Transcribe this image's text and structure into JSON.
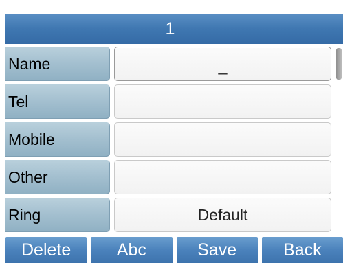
{
  "title": "1",
  "form": {
    "rows": [
      {
        "label": "Name",
        "value": "_"
      },
      {
        "label": "Tel",
        "value": ""
      },
      {
        "label": "Mobile",
        "value": ""
      },
      {
        "label": "Other",
        "value": ""
      },
      {
        "label": "Ring",
        "value": "Default"
      }
    ]
  },
  "softkeys": {
    "delete": "Delete",
    "abc": "Abc",
    "save": "Save",
    "back": "Back"
  },
  "colors": {
    "title_bar": "#3f77b1",
    "label_bg": "#a3bfcf",
    "field_bg": "#f4f4f4",
    "softkey_bg": "#4b82bc"
  }
}
